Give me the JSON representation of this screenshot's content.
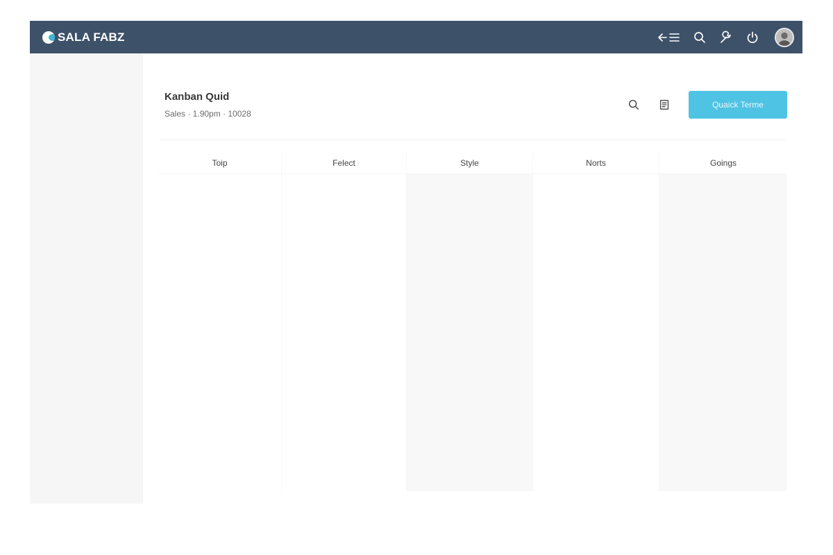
{
  "app": {
    "brand": "SALA FABZ"
  },
  "topbar": {
    "icons": [
      "back-menu-icon",
      "search-icon",
      "wrench-icon",
      "power-icon",
      "avatar"
    ]
  },
  "board": {
    "title": "Kanban Quid",
    "meta": "Sales · 1.90pm · 10028",
    "primary_button_label": "Quaick Terme"
  },
  "columns": [
    {
      "label": "Toip",
      "shaded": false
    },
    {
      "label": "Felect",
      "shaded": false
    },
    {
      "label": "Style",
      "shaded": true
    },
    {
      "label": "Norts",
      "shaded": false
    },
    {
      "label": "Goings",
      "shaded": true
    }
  ],
  "colors": {
    "topbar": "#3d5169",
    "accent": "#4fc3e3",
    "sidebar": "#f6f6f6"
  }
}
